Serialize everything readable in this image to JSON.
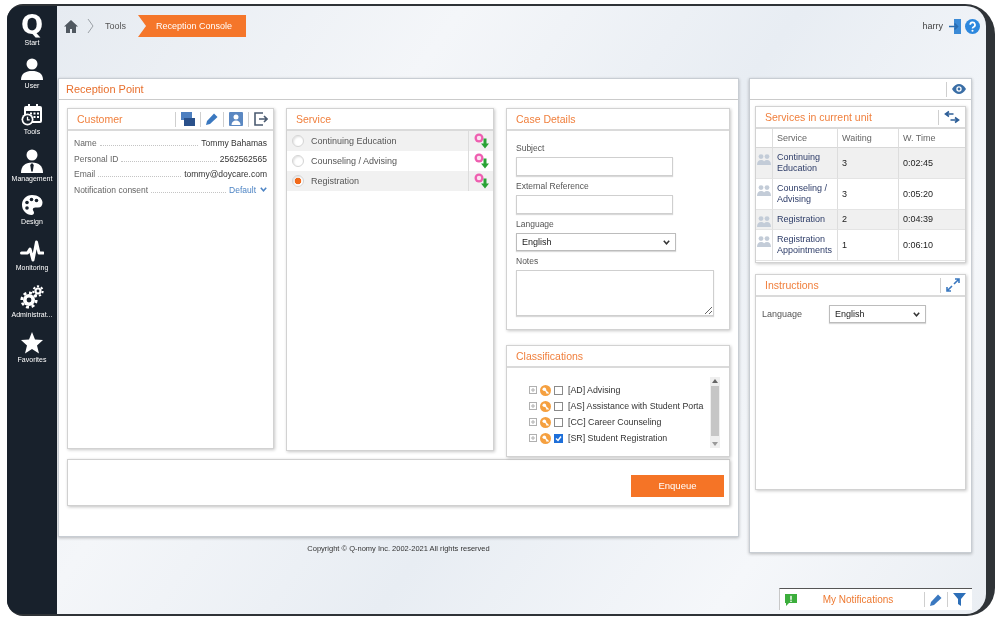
{
  "sidebar": {
    "logo": "Q",
    "items": [
      {
        "label": "Start"
      },
      {
        "label": "User"
      },
      {
        "label": "Tools"
      },
      {
        "label": "Management"
      },
      {
        "label": "Design"
      },
      {
        "label": "Monitoring"
      },
      {
        "label": "Administrat..."
      },
      {
        "label": "Favorites"
      }
    ]
  },
  "breadcrumb": [
    {
      "label": "Tools",
      "selected": false
    },
    {
      "label": "Reception Console",
      "selected": true
    }
  ],
  "user": {
    "name": "harry"
  },
  "reception_point": {
    "title": "Reception Point",
    "customer": {
      "title": "Customer",
      "fields": [
        {
          "label": "Name",
          "value": "Tommy Bahamas",
          "kind": "text"
        },
        {
          "label": "Personal ID",
          "value": "2562562565",
          "kind": "text"
        },
        {
          "label": "Email",
          "value": "tommy@doycare.com",
          "kind": "text"
        },
        {
          "label": "Notification consent",
          "value": "Default",
          "kind": "dropdown"
        }
      ]
    },
    "service": {
      "title": "Service",
      "items": [
        {
          "label": "Continuing Education",
          "selected": false
        },
        {
          "label": "Counseling / Advising",
          "selected": false
        },
        {
          "label": "Registration",
          "selected": true
        }
      ]
    },
    "case_details": {
      "title": "Case Details",
      "fields": [
        {
          "label": "Subject",
          "kind": "input"
        },
        {
          "label": "External Reference",
          "kind": "input"
        },
        {
          "label": "Language",
          "kind": "select",
          "value": "English"
        },
        {
          "label": "Notes",
          "kind": "textarea"
        }
      ]
    },
    "classifications": {
      "title": "Classifications",
      "items": [
        {
          "label": "[AD] Advising",
          "checked": false
        },
        {
          "label": "[AS] Assistance with Student Porta",
          "checked": false
        },
        {
          "label": "[CC] Career Counseling",
          "checked": false
        },
        {
          "label": "[SR] Student Registration",
          "checked": true
        }
      ]
    },
    "enqueue_button": "Enqueue"
  },
  "copyright": "Copyright © Q-nomy Inc. 2002-2021 All rights reserved",
  "services_in_unit": {
    "title": "Services in current unit",
    "columns": [
      "Service",
      "Waiting",
      "W. Time"
    ],
    "rows": [
      {
        "service": "Continuing Education",
        "waiting": "3",
        "wait_time": "0:02:45"
      },
      {
        "service": "Counseling / Advising",
        "waiting": "3",
        "wait_time": "0:05:20"
      },
      {
        "service": "Registration",
        "waiting": "2",
        "wait_time": "0:04:39"
      },
      {
        "service": "Registration Appointments",
        "waiting": "1",
        "wait_time": "0:06:10"
      }
    ]
  },
  "instructions": {
    "title": "Instructions",
    "language_label": "Language",
    "language": "English"
  },
  "notifications": {
    "title": "My Notifications"
  }
}
